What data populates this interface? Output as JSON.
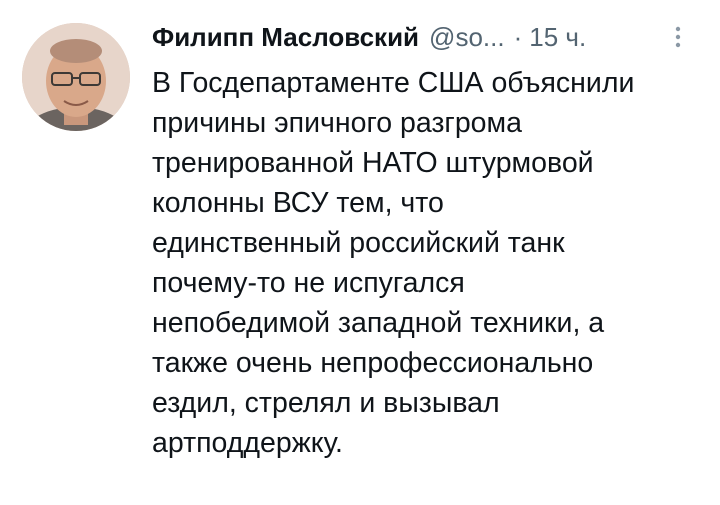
{
  "tweet": {
    "author_name": "Филипп Масловский",
    "handle": "@so...",
    "separator": "·",
    "time": "15 ч.",
    "avatar_icon": "user-avatar-photo",
    "more_icon": "more-vertical-icon",
    "text_lines": [
      "В Госдепартаменте США объяснили",
      "причины эпичного разгрома",
      "тренированной НАТО штурмовой",
      "колонны ВСУ тем, что",
      "единственный российский танк",
      "почему-то не испугался",
      "непобедимой западной техники, а",
      "также очень непрофессионально",
      "ездил, стрелял и вызывал",
      "артподдержку."
    ]
  },
  "colors": {
    "text": "#0f1419",
    "secondary": "#536471",
    "background": "#ffffff"
  }
}
